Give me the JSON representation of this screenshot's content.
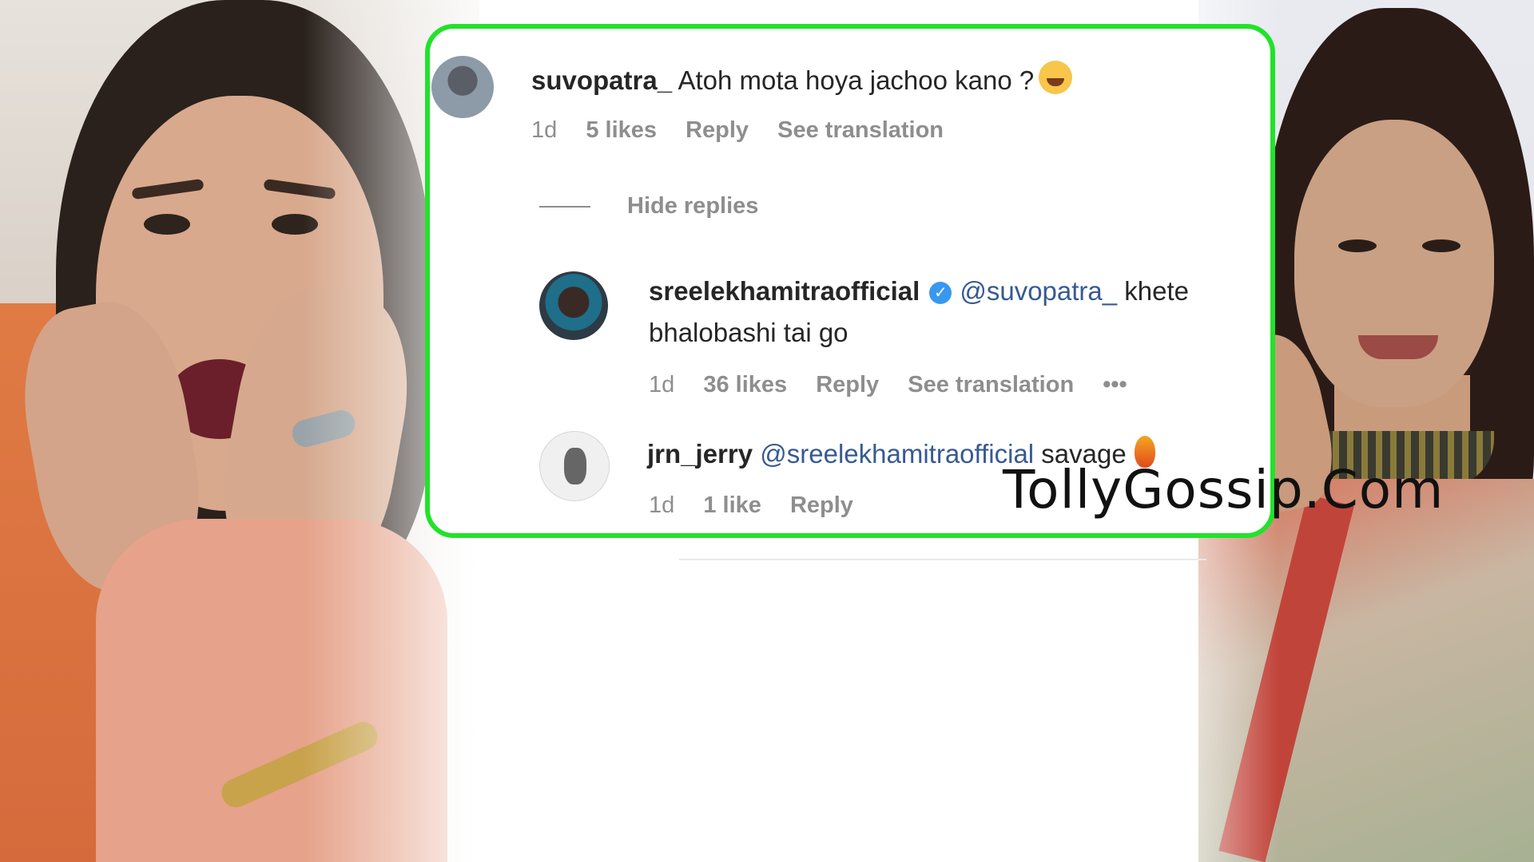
{
  "comments": [
    {
      "username": "suvopatra_",
      "text": "Atoh mota hoya jachoo kano ?",
      "emoji": "laughing-tears-emoji",
      "time": "1d",
      "likes": "5 likes",
      "reply": "Reply",
      "translate": "See translation"
    }
  ],
  "hide_replies": "Hide replies",
  "replies": [
    {
      "username": "sreelekhamitraofficial",
      "verified": true,
      "mention": "@suvopatra_",
      "text_line1": "khete",
      "text_line2": "bhalobashi tai go",
      "time": "1d",
      "likes": "36 likes",
      "reply": "Reply",
      "translate": "See translation",
      "more": "•••"
    },
    {
      "username": "jrn_jerry",
      "mention": "@sreelekhamitraofficial",
      "text": "savage",
      "emoji": "fire-emoji",
      "time": "1d",
      "likes": "1 like",
      "reply": "Reply"
    }
  ],
  "watermark": "TollyGossip.Com",
  "colors": {
    "border": "#22e22b",
    "mention": "#375a93",
    "meta": "#8e8e8e",
    "verified": "#3897f0"
  }
}
